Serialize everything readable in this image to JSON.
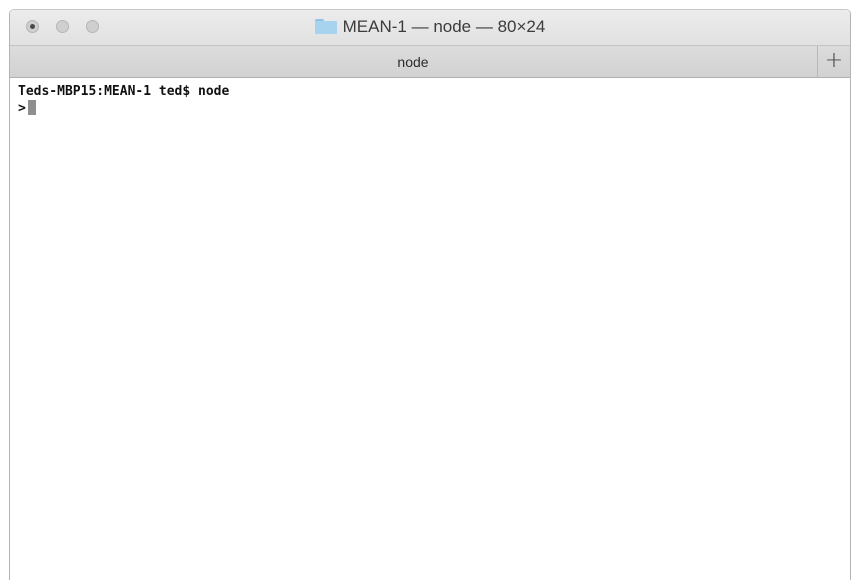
{
  "window": {
    "title": "MEAN-1 — node — 80×24",
    "folder_icon": "folder-icon"
  },
  "tabbar": {
    "active_tab": "node",
    "new_tab_label": "+"
  },
  "terminal": {
    "lines": [
      "Teds-MBP15:MEAN-1 ted$ node",
      ">"
    ]
  },
  "colors": {
    "titlebar": "#e6e6e6",
    "tabbar": "#d6d6d6",
    "folder": "#a8d3ef",
    "cursor": "#8f8f8f",
    "text": "#111111"
  }
}
